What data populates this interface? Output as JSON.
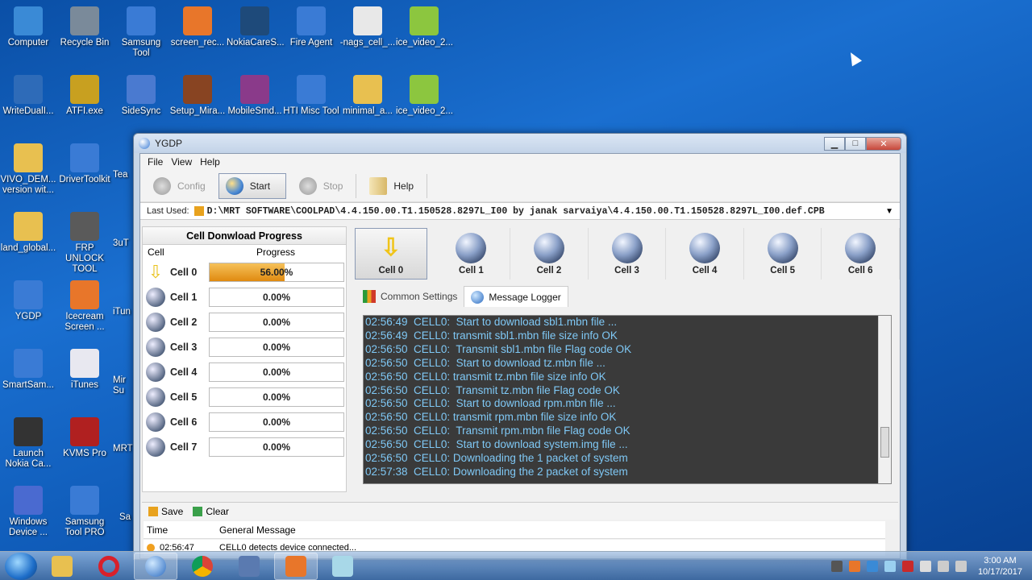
{
  "desktop_icons": [
    {
      "label": "Computer",
      "icon": "computer-icon",
      "color": "#3a8ad6"
    },
    {
      "label": "Recycle Bin",
      "icon": "recycle-bin-icon",
      "color": "#7a8a9a"
    },
    {
      "label": "Samsung Tool",
      "icon": "samsung-tool-icon",
      "color": "#3a7bd5"
    },
    {
      "label": "screen_rec...",
      "icon": "screen-recorder-icon",
      "color": "#e8762a"
    },
    {
      "label": "NokiaCareS...",
      "icon": "nokia-care-icon",
      "color": "#1e4a7a"
    },
    {
      "label": "Fire Agent",
      "icon": "fire-agent-icon",
      "color": "#3a7bd5"
    },
    {
      "label": "-nags_cell_...",
      "icon": "file-icon",
      "color": "#e8e8e8"
    },
    {
      "label": "ice_video_2...",
      "icon": "video-icon",
      "color": "#8cc63f"
    },
    {
      "label": "WriteDualI...",
      "icon": "write-dual-icon",
      "color": "#2e6bb8"
    },
    {
      "label": "ATFI.exe",
      "icon": "atf-icon",
      "color": "#c8a020"
    },
    {
      "label": "SideSync",
      "icon": "sidesync-icon",
      "color": "#4a7ad0"
    },
    {
      "label": "Setup_Mira...",
      "icon": "setup-icon",
      "color": "#884422"
    },
    {
      "label": "MobileSmd...",
      "icon": "winrar-icon",
      "color": "#8a3a8a"
    },
    {
      "label": "HTI Misc Tool",
      "icon": "hti-tool-icon",
      "color": "#3a7bd5"
    },
    {
      "label": "minimal_a...",
      "icon": "folder-icon",
      "color": "#e8c050"
    },
    {
      "label": "ice_video_2...",
      "icon": "video-icon",
      "color": "#8cc63f"
    },
    {
      "label": "VIVO_DEM... version wit...",
      "icon": "folder-icon",
      "color": "#e8c050"
    },
    {
      "label": "DriverToolkit",
      "icon": "driver-toolkit-icon",
      "color": "#3a7bd5"
    },
    {
      "label": "land_global...",
      "icon": "folder-icon",
      "color": "#e8c050"
    },
    {
      "label": "FRP UNLOCK TOOL",
      "icon": "frp-tool-icon",
      "color": "#5a5a5a"
    },
    {
      "label": "YGDP",
      "icon": "ygdp-icon",
      "color": "#3a7bd5"
    },
    {
      "label": "Icecream Screen ...",
      "icon": "icecream-icon",
      "color": "#e8762a"
    },
    {
      "label": "SmartSam...",
      "icon": "smartsam-icon",
      "color": "#3a7bd5"
    },
    {
      "label": "iTunes",
      "icon": "itunes-icon",
      "color": "#e8e8f0"
    },
    {
      "label": "Launch Nokia Ca...",
      "icon": "nokia-launch-icon",
      "color": "#333333"
    },
    {
      "label": "KVMS Pro",
      "icon": "kvms-icon",
      "color": "#b02020"
    },
    {
      "label": "Windows Device ...",
      "icon": "windows-device-icon",
      "color": "#4a6ad0"
    },
    {
      "label": "Samsung Tool PRO",
      "icon": "samsung-tool-pro-icon",
      "color": "#3a7bd5"
    }
  ],
  "desktop_partial_labels": [
    "Tea",
    "3uT",
    "iTun",
    "Mir Su",
    "MRT",
    "Sa"
  ],
  "window": {
    "title": "YGDP",
    "menu": [
      "File",
      "View",
      "Help"
    ],
    "toolbar": {
      "config_label": "Config",
      "start_label": "Start",
      "stop_label": "Stop",
      "help_label": "Help"
    },
    "last_used_label": "Last Used:",
    "last_used_path": "D:\\MRT SOFTWARE\\COOLPAD\\4.4.150.00.T1.150528.8297L_I00 by janak sarvaiya\\4.4.150.00.T1.150528.8297L_I00.def.CPB",
    "progress_panel": {
      "title": "Cell Donwload Progress",
      "col_cell": "Cell",
      "col_progress": "Progress",
      "cells": [
        {
          "name": "Cell 0",
          "progress_text": "56.00%",
          "progress": 0.56,
          "icon": "download-arrow-icon"
        },
        {
          "name": "Cell 1",
          "progress_text": "0.00%",
          "progress": 0,
          "icon": "globe-icon"
        },
        {
          "name": "Cell 2",
          "progress_text": "0.00%",
          "progress": 0,
          "icon": "globe-icon"
        },
        {
          "name": "Cell 3",
          "progress_text": "0.00%",
          "progress": 0,
          "icon": "globe-icon"
        },
        {
          "name": "Cell 4",
          "progress_text": "0.00%",
          "progress": 0,
          "icon": "globe-icon"
        },
        {
          "name": "Cell 5",
          "progress_text": "0.00%",
          "progress": 0,
          "icon": "globe-icon"
        },
        {
          "name": "Cell 6",
          "progress_text": "0.00%",
          "progress": 0,
          "icon": "globe-icon"
        },
        {
          "name": "Cell 7",
          "progress_text": "0.00%",
          "progress": 0,
          "icon": "globe-icon"
        }
      ]
    },
    "cell_buttons": [
      "Cell 0",
      "Cell 1",
      "Cell 2",
      "Cell 3",
      "Cell 4",
      "Cell 5",
      "Cell 6"
    ],
    "tabs": [
      {
        "label": "Common Settings",
        "icon": "chart-icon"
      },
      {
        "label": "Message Logger",
        "icon": "globe-icon"
      }
    ],
    "log_lines": [
      "02:56:49  CELL0:  Start to download sbl1.mbn file ...",
      "02:56:49  CELL0: transmit sbl1.mbn file size info OK",
      "02:56:50  CELL0:  Transmit sbl1.mbn file Flag code OK",
      "02:56:50  CELL0:  Start to download tz.mbn file ...",
      "02:56:50  CELL0: transmit tz.mbn file size info OK",
      "02:56:50  CELL0:  Transmit tz.mbn file Flag code OK",
      "02:56:50  CELL0:  Start to download rpm.mbn file ...",
      "02:56:50  CELL0: transmit rpm.mbn file size info OK",
      "02:56:50  CELL0:  Transmit rpm.mbn file Flag code OK",
      "02:56:50  CELL0:  Start to download system.img file ...",
      "02:56:50  CELL0: Downloading the 1 packet of system",
      "02:57:38  CELL0: Downloading the 2 packet of system"
    ],
    "bottom": {
      "save_label": "Save",
      "clear_label": "Clear",
      "col_time": "Time",
      "col_message": "General Message",
      "rows": [
        {
          "time": "02:56:47",
          "message": "CELL0 detects device connected..."
        }
      ]
    }
  },
  "taskbar": {
    "items": [
      "explorer",
      "opera",
      "ygdp",
      "chrome",
      "network-tool",
      "icecream",
      "notepad"
    ],
    "time": "3:00 AM",
    "date": "10/17/2017"
  },
  "colors": {
    "progress_fill": "#e08a10",
    "log_text": "#7fc8f5",
    "log_bg": "#3a3a3a"
  }
}
